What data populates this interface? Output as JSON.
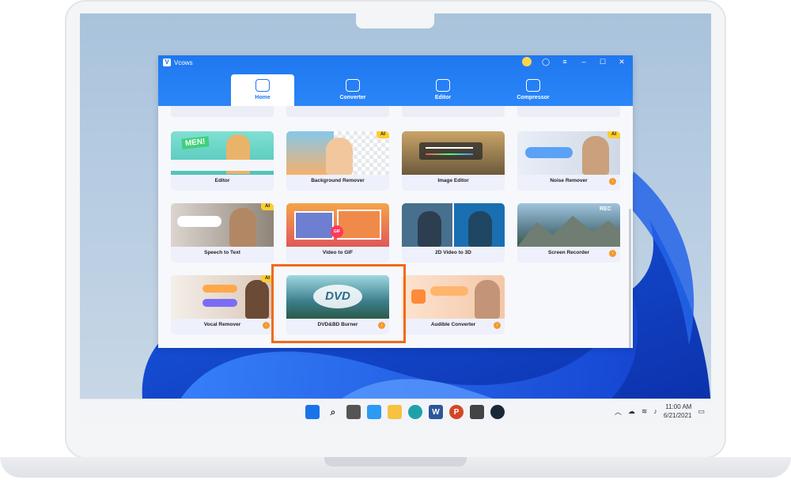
{
  "app": {
    "name": "Vcows"
  },
  "tabs": [
    {
      "label": "Home",
      "active": true
    },
    {
      "label": "Converter",
      "active": false
    },
    {
      "label": "Editor",
      "active": false
    },
    {
      "label": "Compressor",
      "active": false
    }
  ],
  "cards": [
    {
      "label": "Editor",
      "ai": false,
      "download": false
    },
    {
      "label": "Background Remover",
      "ai": true,
      "download": false
    },
    {
      "label": "Image Editor",
      "ai": false,
      "download": false
    },
    {
      "label": "Noise Remover",
      "ai": true,
      "download": true
    },
    {
      "label": "Speech to Text",
      "ai": true,
      "download": false
    },
    {
      "label": "Video to GIF",
      "ai": false,
      "download": false
    },
    {
      "label": "2D Video to 3D",
      "ai": false,
      "download": false
    },
    {
      "label": "Screen Recorder",
      "ai": false,
      "download": true
    },
    {
      "label": "Vocal Remover",
      "ai": true,
      "download": true
    },
    {
      "label": "DVD&BD Burner",
      "ai": false,
      "download": true
    },
    {
      "label": "Audible Converter",
      "ai": false,
      "download": true
    }
  ],
  "thumb_text": {
    "editor": "MEN!",
    "dvd": "DVD",
    "gif": "GIF",
    "rec": "REC"
  },
  "badge": {
    "ai": "AI",
    "download": "↓"
  },
  "taskbar": {
    "time": "11:00 AM",
    "date": "6/21/2021"
  },
  "colors": {
    "accent": "#1f77ef",
    "highlight": "#f06a1c",
    "ai_badge": "#ffcd2e",
    "download": "#f39a2a"
  }
}
